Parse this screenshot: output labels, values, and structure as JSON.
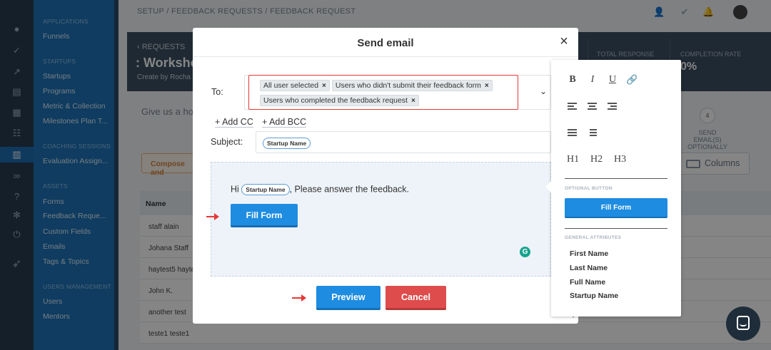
{
  "sidebar": {
    "sections": [
      {
        "title": "APPLICATIONS",
        "items": [
          "Funnels"
        ]
      },
      {
        "title": "STARTUPS",
        "items": [
          "Startups",
          "Programs",
          "Metric & Collection",
          "Milestones Plan T..."
        ]
      },
      {
        "title": "COACHING SESSIONS",
        "items": [
          "Evaluation Assign..."
        ]
      },
      {
        "title": "ASSETS",
        "items": [
          "Forms",
          "Feedback Reque...",
          "Custom Fields",
          "Emails",
          "Tags & Topics"
        ]
      },
      {
        "title": "USERS MANAGEMENT",
        "items": [
          "Users",
          "Mentors"
        ]
      }
    ]
  },
  "breadcrumb": "SETUP  /  FEEDBACK REQUESTS  /  FEEDBACK REQUEST",
  "header": {
    "back_label": "REQUESTS",
    "title": ": Worksho",
    "subtitle": "Create by Rocha",
    "stats": [
      {
        "label": "TOTAL RESPONSE",
        "value": ""
      },
      {
        "label": "COMPLETION RATE",
        "value": "0%"
      }
    ]
  },
  "background": {
    "intro_text": "Give us a ho",
    "compose_label": "Compose and",
    "step_number": "4",
    "step_label": "SEND EMAIL(S) OPTIONALLY",
    "columns_label": "Columns",
    "table_header": "Name",
    "rows": [
      "staff alain",
      "Johana Staff",
      "haytest5 hayte",
      "John K.",
      "another test",
      "teste1 teste1"
    ]
  },
  "modal": {
    "title": "Send email",
    "to_label": "To:",
    "recipients": [
      "All user selected",
      "Users who didn't submit their feedback form",
      "Users who completed the feedback request"
    ],
    "add_cc": "+ Add CC",
    "add_bcc": "+ Add BCC",
    "subject_label": "Subject:",
    "subject_token": "Startup Name",
    "body_greeting": "Hi",
    "body_token": "Startup Name",
    "body_text": ", Please answer the feedback.",
    "fill_form_label": "Fill Form",
    "preview_label": "Preview",
    "cancel_label": "Cancel"
  },
  "toolbar_panel": {
    "format_buttons": [
      "B",
      "I",
      "U"
    ],
    "headings": [
      "H1",
      "H2",
      "H3"
    ],
    "optional_button_heading": "OPTIONAL BUTTON",
    "optional_button_label": "Fill Form",
    "general_attributes_heading": "GENERAL ATTRIBUTES",
    "attributes": [
      "First Name",
      "Last Name",
      "Full Name",
      "Startup Name"
    ]
  },
  "colors": {
    "primary": "#1e8ce0",
    "danger": "#de4c4c",
    "highlight_border": "#e53935",
    "sidebar": "#1e73b8"
  }
}
